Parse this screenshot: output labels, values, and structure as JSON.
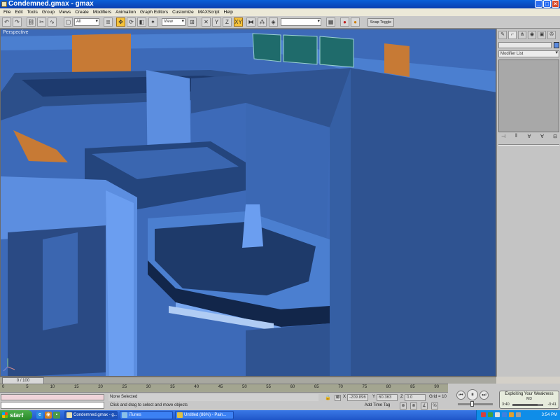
{
  "window": {
    "title": "Condemned.gmax - gmax",
    "buttons": {
      "minimize": "_",
      "maximize": "□",
      "close": "×"
    }
  },
  "menu": [
    "File",
    "Edit",
    "Tools",
    "Group",
    "Views",
    "Create",
    "Modifiers",
    "Animation",
    "Graph Editors",
    "Customize",
    "MAXScript",
    "Help"
  ],
  "toolbar": {
    "selection_filter": "All",
    "reference_coord": "View",
    "named_selection": "",
    "snap_toggle": "Snap Toggle"
  },
  "viewport": {
    "label": "Perspective"
  },
  "command_panel": {
    "tabs": [
      "create-icon",
      "modify-icon",
      "hierarchy-icon",
      "motion-icon",
      "display-icon",
      "utilities-icon"
    ],
    "modifier_list": "Modifier List",
    "stack_buttons": [
      "pin-stack-icon",
      "show-end-result-icon",
      "make-unique-icon",
      "remove-modifier-icon",
      "configure-sets-icon"
    ],
    "colors": {
      "object_color": "#5a8ae0"
    }
  },
  "timeline": {
    "frame_display": "0 / 100",
    "ticks": [
      "0",
      "5",
      "10",
      "15",
      "20",
      "25",
      "30",
      "35",
      "40",
      "45",
      "50",
      "55",
      "60",
      "65",
      "70",
      "75",
      "80",
      "85",
      "90"
    ]
  },
  "status": {
    "selection": "None Selected",
    "hint": "Click and drag to select and move objects",
    "x_label": "X",
    "x_value": "-209.896",
    "y_label": "Y",
    "y_value": "60.363",
    "z_label": "Z",
    "z_value": "0.0",
    "grid": "Grid = 10",
    "add_time_tag": "Add Time Tag"
  },
  "player": {
    "song": "Exploiting Your Weakness",
    "artist": "M3",
    "elapsed": "3:40",
    "remaining": "-0:41",
    "progress": 0.84,
    "volume": 0.6
  },
  "taskbar": {
    "start": "start",
    "tasks": [
      {
        "label": "Condemned.gmax - g...",
        "active": true
      },
      {
        "label": "iTunes",
        "active": false
      },
      {
        "label": "Untitled (86%) - Pain...",
        "active": false
      }
    ],
    "clock": "3:54 PM"
  }
}
